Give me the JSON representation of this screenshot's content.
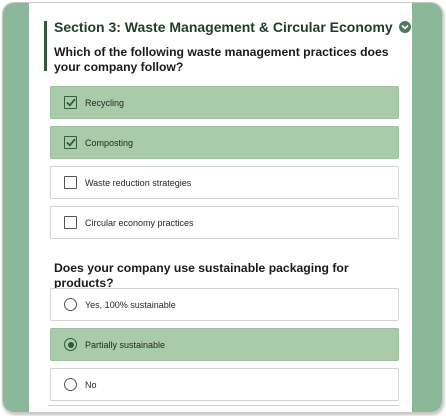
{
  "section": {
    "title": "Section 3: Waste Management & Circular Economy",
    "toggle_icon": "chevron-down-icon"
  },
  "waste_question": {
    "text": "Which of the following waste management practices does your company follow?",
    "options": [
      {
        "label": "Recycling",
        "checked": true
      },
      {
        "label": "Composting",
        "checked": true
      },
      {
        "label": "Waste reduction strategies",
        "checked": false
      },
      {
        "label": "Circular economy practices",
        "checked": false
      }
    ]
  },
  "packaging_question": {
    "text": "Does your company use sustainable packaging for products?",
    "options": [
      {
        "label": "Yes, 100% sustainable",
        "selected": false
      },
      {
        "label": "Partially sustainable",
        "selected": true
      },
      {
        "label": "No",
        "selected": false
      }
    ]
  },
  "colors": {
    "accent": "#2f5a3a",
    "selected_fill": "#a9cba9",
    "rail": "#8bb898"
  }
}
